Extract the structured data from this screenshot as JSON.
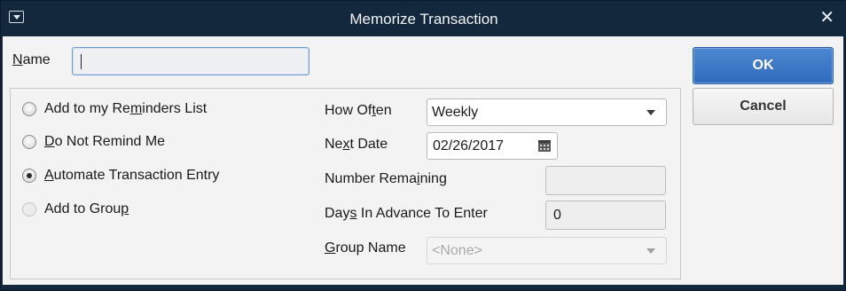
{
  "window": {
    "title": "Memorize Transaction",
    "close_glyph": "✕"
  },
  "name_field": {
    "label_underlined": "N",
    "label_rest": "ame",
    "value": ""
  },
  "radios": [
    {
      "pre": "Add to my Re",
      "u": "m",
      "post": "inders List",
      "checked": false,
      "disabled": false
    },
    {
      "pre": "",
      "u": "D",
      "post": "o Not Remind Me",
      "checked": false,
      "disabled": false
    },
    {
      "pre": "",
      "u": "A",
      "post": "utomate Transaction Entry",
      "checked": true,
      "disabled": false
    },
    {
      "pre": "Add to Grou",
      "u": "p",
      "post": "",
      "checked": false,
      "disabled": true
    }
  ],
  "how_often": {
    "label_pre": "How Of",
    "label_u": "t",
    "label_post": "en",
    "value": "Weekly"
  },
  "next_date": {
    "label_pre": "Ne",
    "label_u": "x",
    "label_post": "t Date",
    "value": "02/26/2017"
  },
  "number_remaining": {
    "label_pre": "Number Rema",
    "label_u": "i",
    "label_post": "ning",
    "value": ""
  },
  "days_in_advance": {
    "label_pre": "Day",
    "label_u": "s",
    "label_post": " In Advance To Enter",
    "value": "0"
  },
  "group_name": {
    "label_pre": "",
    "label_u": "G",
    "label_post": "roup Name",
    "value": "<None>"
  },
  "buttons": {
    "ok": "OK",
    "cancel": "Cancel"
  },
  "colors": {
    "titlebar": "#13283d",
    "ok_button": "#3a77c6",
    "dialog_background": "#f3f3f3"
  }
}
